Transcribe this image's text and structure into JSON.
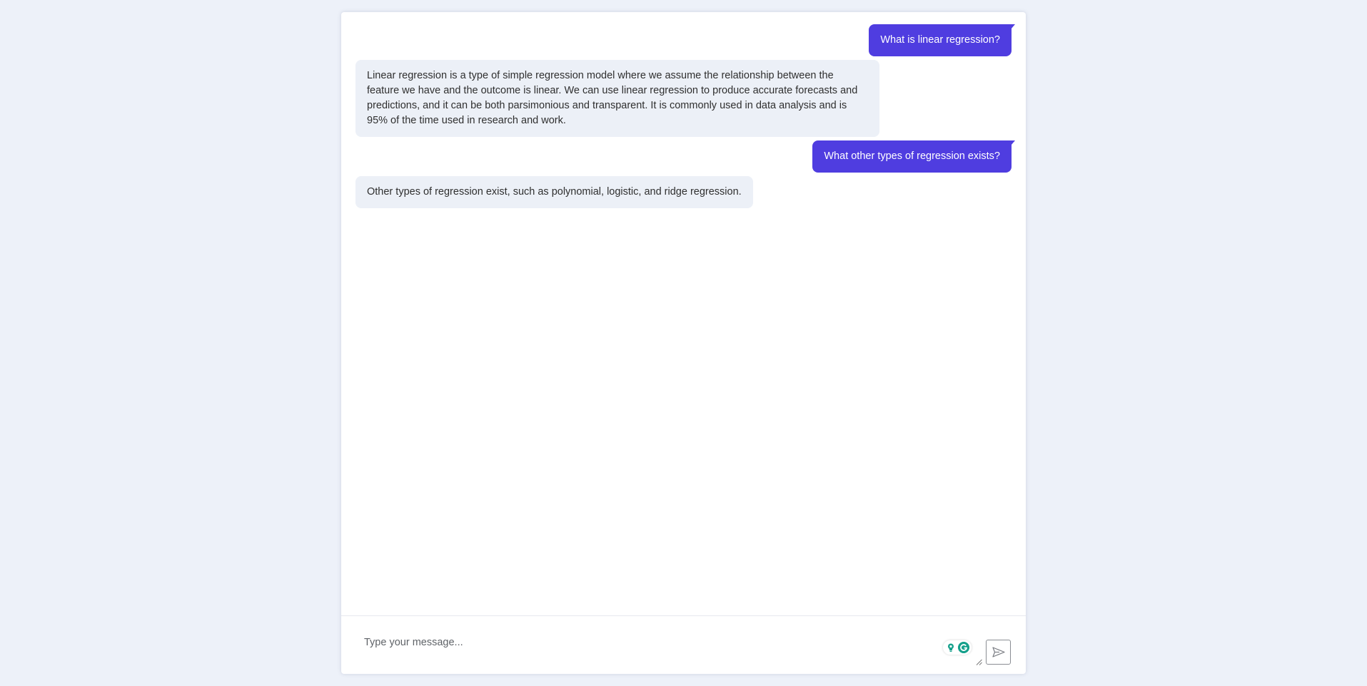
{
  "colors": {
    "page_background": "#edf1f9",
    "user_bubble": "#4f3de0",
    "bot_bubble": "#ecf0f7",
    "extension_accent": "#15a08b"
  },
  "messages": [
    {
      "role": "user",
      "text": "What is linear regression?"
    },
    {
      "role": "bot",
      "text": "Linear regression is a type of simple regression model where we assume the relationship between the feature we have and the outcome is linear. We can use linear regression to produce accurate forecasts and predictions, and it can be both parsimonious and transparent. It is commonly used in data analysis and is 95% of the time used in research and work."
    },
    {
      "role": "user",
      "text": "What other types of regression exists?"
    },
    {
      "role": "bot",
      "text": "Other types of regression exist, such as polynomial, logistic, and ridge regression."
    }
  ],
  "composer": {
    "placeholder": "Type your message...",
    "value": "",
    "send_icon": "send-icon",
    "extension_icons": [
      "lightbulb-icon",
      "grammarly-icon"
    ]
  }
}
